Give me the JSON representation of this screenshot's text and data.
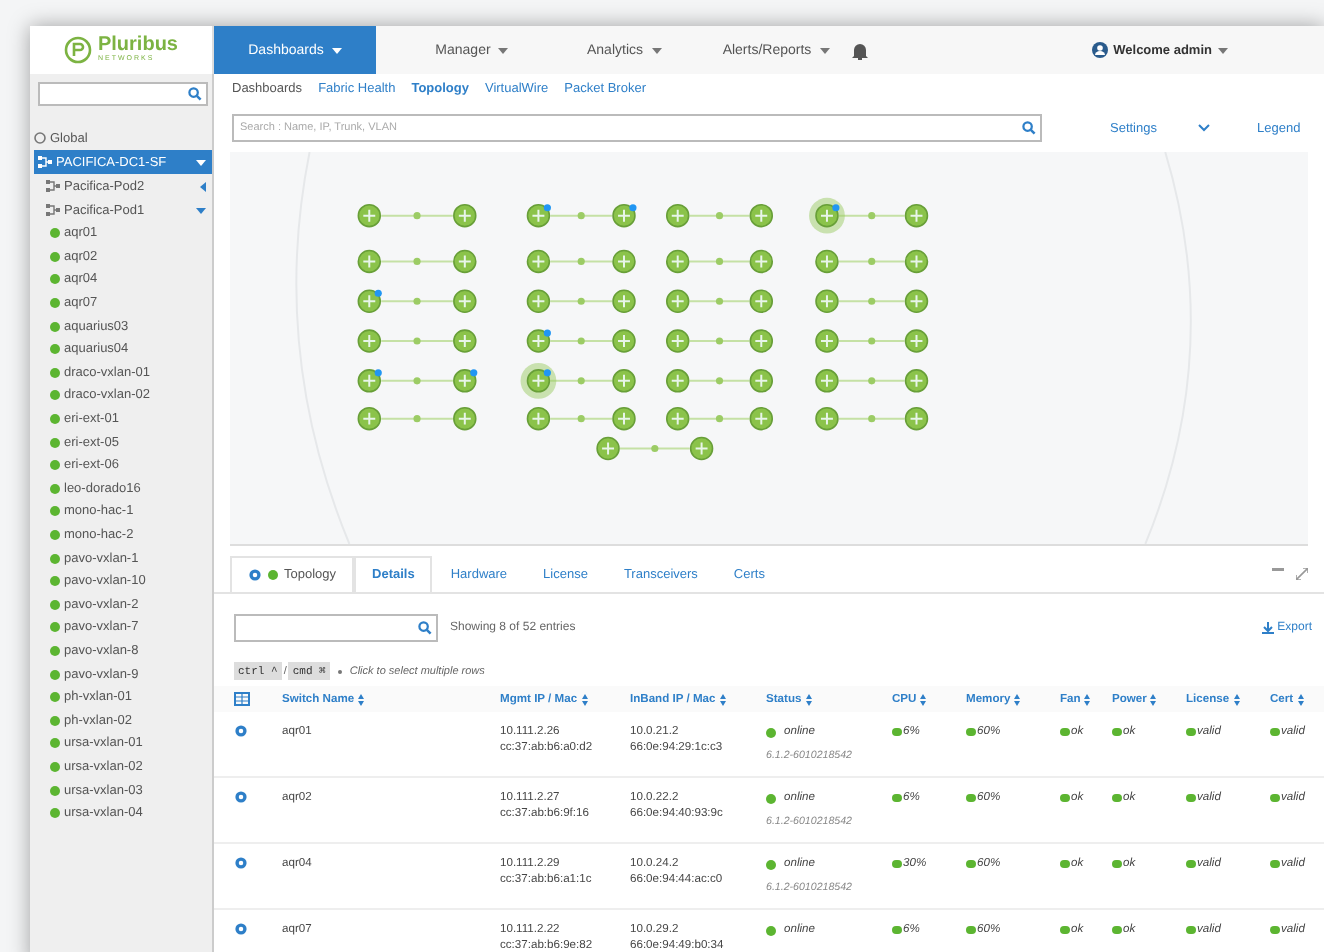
{
  "logo": {
    "name": "Pluribus",
    "tagline": "NETWORKS"
  },
  "menu": [
    {
      "label": "Dashboards",
      "selected": true
    },
    {
      "label": "Manager",
      "selected": false
    },
    {
      "label": "Analytics",
      "selected": false
    },
    {
      "label": "Alerts/Reports",
      "selected": false
    }
  ],
  "user": {
    "label": "Welcome admin"
  },
  "sidebar": {
    "root": {
      "label": "Global"
    },
    "fabric": {
      "label": "PACIFICA-DC1-SF",
      "selected": true,
      "expanded": true,
      "children": [
        {
          "label": "Pacifica-Pod2",
          "expanded": false
        },
        {
          "label": "Pacifica-Pod1",
          "expanded": true,
          "children": [
            {
              "label": "aqr01"
            },
            {
              "label": "aqr02"
            },
            {
              "label": "aqr04"
            },
            {
              "label": "aqr07"
            },
            {
              "label": "aquarius03"
            },
            {
              "label": "aquarius04"
            },
            {
              "label": "draco-vxlan-01"
            },
            {
              "label": "draco-vxlan-02"
            },
            {
              "label": "eri-ext-01"
            },
            {
              "label": "eri-ext-05"
            },
            {
              "label": "eri-ext-06"
            },
            {
              "label": "leo-dorado16"
            },
            {
              "label": "mono-hac-1"
            },
            {
              "label": "mono-hac-2"
            },
            {
              "label": "pavo-vxlan-1"
            },
            {
              "label": "pavo-vxlan-10"
            },
            {
              "label": "pavo-vxlan-2"
            },
            {
              "label": "pavo-vxlan-7"
            },
            {
              "label": "pavo-vxlan-8"
            },
            {
              "label": "pavo-vxlan-9"
            },
            {
              "label": "ph-vxlan-01"
            },
            {
              "label": "ph-vxlan-02"
            },
            {
              "label": "ursa-vxlan-01"
            },
            {
              "label": "ursa-vxlan-02"
            },
            {
              "label": "ursa-vxlan-03"
            },
            {
              "label": "ursa-vxlan-04"
            }
          ]
        }
      ]
    }
  },
  "subnav": [
    {
      "label": "Dashboards",
      "selected": false,
      "kind": "plain"
    },
    {
      "label": "Fabric Health",
      "selected": false,
      "kind": "link"
    },
    {
      "label": "Topology",
      "selected": true,
      "kind": "link"
    },
    {
      "label": "VirtualWire",
      "selected": false,
      "kind": "link"
    },
    {
      "label": "Packet Broker",
      "selected": false,
      "kind": "link"
    }
  ],
  "topology_search": {
    "placeholder": "Search : Name, IP, Trunk, VLAN"
  },
  "topology_tools": {
    "settings": "Settings",
    "legend": "Legend"
  },
  "details_tabs": [
    {
      "label": "Topology",
      "selected": false
    },
    {
      "label": "Details",
      "selected": true
    },
    {
      "label": "Hardware",
      "selected": false
    },
    {
      "label": "License",
      "selected": false
    },
    {
      "label": "Transceivers",
      "selected": false
    },
    {
      "label": "Certs",
      "selected": false
    }
  ],
  "table": {
    "summary": "Showing 8 of 52 entries",
    "export": "Export",
    "keys": [
      "ctrl ^",
      "/",
      "cmd ⌘"
    ],
    "hint": "Click to select multiple rows",
    "columns": [
      "Switch Name",
      "Mgmt IP / Mac",
      "InBand IP / Mac",
      "Status",
      "CPU",
      "Memory",
      "Fan",
      "Power",
      "License",
      "Cert"
    ],
    "rows": [
      {
        "name": "aqr01",
        "mgmt_ip": "10.111.2.26",
        "mgmt_mac": "cc:37:ab:b6:a0:d2",
        "inband_ip": "10.0.21.2",
        "inband_mac": "66:0e:94:29:1c:c3",
        "status": "online",
        "version": "6.1.2-6010218542",
        "cpu": "6%",
        "memory": "60%",
        "fan": "ok",
        "power": "ok",
        "license": "valid",
        "cert": "valid"
      },
      {
        "name": "aqr02",
        "mgmt_ip": "10.111.2.27",
        "mgmt_mac": "cc:37:ab:b6:9f:16",
        "inband_ip": "10.0.22.2",
        "inband_mac": "66:0e:94:40:93:9c",
        "status": "online",
        "version": "6.1.2-6010218542",
        "cpu": "6%",
        "memory": "60%",
        "fan": "ok",
        "power": "ok",
        "license": "valid",
        "cert": "valid"
      },
      {
        "name": "aqr04",
        "mgmt_ip": "10.111.2.29",
        "mgmt_mac": "cc:37:ab:b6:a1:1c",
        "inband_ip": "10.0.24.2",
        "inband_mac": "66:0e:94:44:ac:c0",
        "status": "online",
        "version": "6.1.2-6010218542",
        "cpu": "30%",
        "memory": "60%",
        "fan": "ok",
        "power": "ok",
        "license": "valid",
        "cert": "valid"
      },
      {
        "name": "aqr07",
        "mgmt_ip": "10.111.2.22",
        "mgmt_mac": "cc:37:ab:b6:9e:82",
        "inband_ip": "10.0.29.2",
        "inband_mac": "66:0e:94:49:b0:34",
        "status": "online",
        "cpu": "6%",
        "memory": "60%",
        "fan": "ok",
        "power": "ok",
        "license": "valid",
        "cert": "valid"
      }
    ]
  }
}
